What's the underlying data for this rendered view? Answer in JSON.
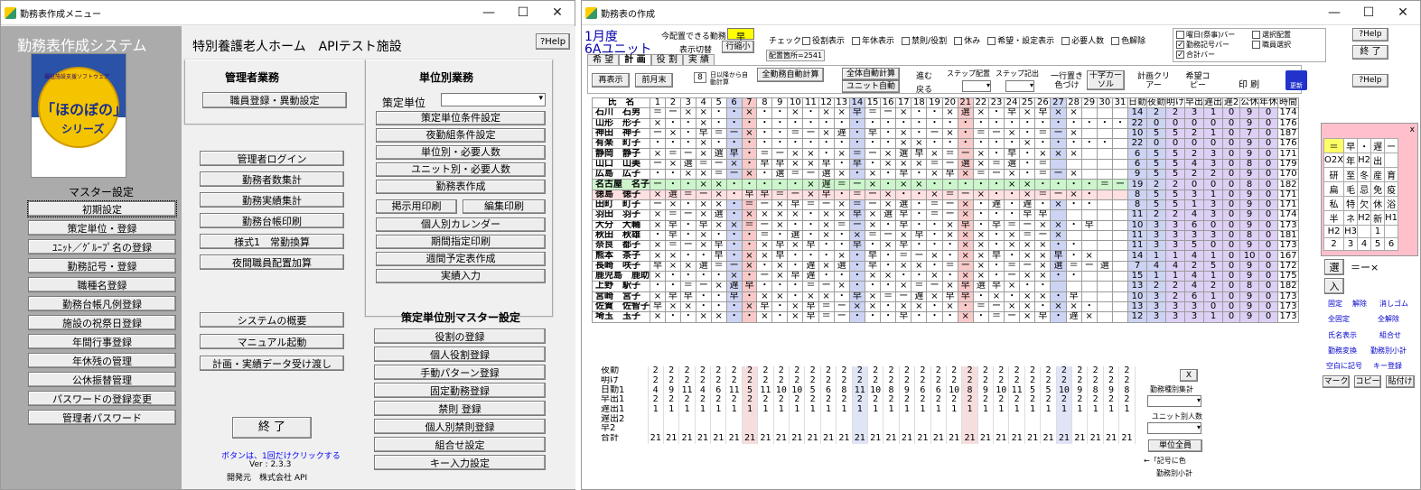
{
  "w1": {
    "title": "勤務表作成メニュー",
    "min": "—",
    "max": "☐",
    "close": "✕"
  },
  "side": {
    "app_title": "勤務表作成システム",
    "logo_arc": "福祉施設支援ソフトウェア",
    "logo_main": "「ほのぼの」",
    "logo_sub": "シリーズ",
    "master": "マスター設定",
    "items": [
      "初期設定",
      "策定単位・登録",
      "ﾕﾆｯﾄ／ｸﾞﾙｰﾌﾟ名の登録",
      "勤務記号・登録",
      "職種名登録",
      "勤務台帳凡例登録",
      "施設の祝祭日登録",
      "年間行事登録",
      "年休残の管理",
      "公休振替管理",
      "パスワードの登録変更",
      "管理者パスワード"
    ]
  },
  "mainp": {
    "facility": "特別養護老人ホーム　APIテスト施設",
    "help": "?Help",
    "admin_h": "管理者業務",
    "staff_btn": "職員登録・異動設定",
    "unit_h": "単位別業務",
    "unit_label": "策定単位",
    "unit_btns": [
      "策定単位条件設定",
      "夜勤組条件設定",
      "単位別・必要人数",
      "ユニット別・必要人数",
      "勤務表作成"
    ],
    "print_a": "掲示用印刷",
    "print_b": "編集印刷",
    "unit_btns2": [
      "個人別カレンダー",
      "期間指定印刷",
      "週間予定表作成",
      "実績入力"
    ],
    "left_btns": [
      "管理者ログイン",
      "勤務者数集計",
      "勤務実績集計",
      "勤務台帳印刷",
      "様式1　常勤換算",
      "夜間職員配置加算"
    ],
    "left_btns2": [
      "システムの概要",
      "マニュアル起動",
      "計画・実績データ受け渡し"
    ],
    "master_h": "策定単位別マスター設定",
    "master_btns": [
      "役割の登録",
      "個人役割登録",
      "手動パターン登録",
      "固定勤務登録",
      "禁則 登録",
      "個人別禁則登録",
      "組合せ設定",
      "キー入力設定"
    ],
    "exit": "終 了",
    "note": "ボタンは、1回だけクリックする",
    "ver": "Ver : 2.3.3",
    "dev": "開発元　株式会社 API"
  },
  "w2": {
    "title": "勤務表の作成",
    "month": "1月度",
    "unit": "6Aユニット",
    "today_lbl": "今配置できる勤務",
    "today_val": "早",
    "view_lbl": "表示切替",
    "view_btn": "行縮小",
    "place": "配置箇所=2541",
    "check_lbl": "チェック",
    "checks": [
      "役割表示",
      "年休表示",
      "禁則/役割",
      "休み",
      "希望・設定表示",
      "必要人数",
      "色解除"
    ],
    "checks2": [
      "曜日(祭事)バー",
      "勤務記号バー",
      "合計バー"
    ],
    "checks3": [
      "選択配置",
      "職員選択"
    ],
    "help": "?Help",
    "end": "終 了",
    "tabs": [
      "希 望",
      "計 画",
      "役 割",
      "実 績"
    ],
    "t_btns": [
      "再表示",
      "前月末"
    ],
    "day_box": "8",
    "day_txt": "日以降から自動計算",
    "auto_all": "全勤務自動計算",
    "auto_full": "全体自動計算",
    "auto_unit": "ユニット自動",
    "go": "進む",
    "back": "戻る",
    "step1": "ステップ配置",
    "step2": "ステップ記出",
    "overwrite": "一行置き色づけ",
    "cross": "十字カーソル",
    "clear": "計画クリアー",
    "copy": "希望コピー",
    "print": "印 刷",
    "save": "更新",
    "colhdr": "氏　名",
    "days": [
      "1",
      "2",
      "3",
      "4",
      "5",
      "6",
      "7",
      "8",
      "9",
      "10",
      "11",
      "12",
      "13",
      "14",
      "15",
      "16",
      "17",
      "18",
      "19",
      "20",
      "21",
      "22",
      "23",
      "24",
      "25",
      "26",
      "27",
      "28",
      "29",
      "30",
      "31"
    ],
    "tothdr": [
      "日勤",
      "夜勤",
      "明け",
      "早出",
      "遅出",
      "遅2",
      "公休",
      "年休",
      "時間"
    ],
    "rows": [
      {
        "n": "石川　石男",
        "d": "＝ー×× ・・×・・×・××早＝ー× ・・× 選× ・早 ×早××",
        "t": [
          "14",
          "2",
          "2",
          "3",
          "1",
          "0",
          "9",
          "0",
          "174"
        ]
      },
      {
        "n": "山形　形子",
        "d": "×・・× ・・・・・・・・・・・・・・・・・・・・・・・・・・・",
        "t": [
          "22",
          "0",
          "0",
          "0",
          "0",
          "0",
          "9",
          "0",
          "176"
        ]
      },
      {
        "n": "神田　神子",
        "d": "ー×・ 早＝ー×・・＝ー× 遅・早・× ・ー× ・＝ー× ・＝ー×",
        "t": [
          "10",
          "5",
          "5",
          "2",
          "1",
          "0",
          "7",
          "0",
          "187"
        ]
      },
      {
        "n": "有楽　町子",
        "d": "・・・×・・・・・・・・・・・・××・・・・・・ ×・・・・・",
        "t": [
          "22",
          "0",
          "0",
          "0",
          "0",
          "0",
          "9",
          "0",
          "176"
        ]
      },
      {
        "n": "静岡　静子",
        "d": "×＝ー× 選早・＝ー××・×＝ー× 選早×＝ー× ・早・×××",
        "t": [
          "6",
          "5",
          "5",
          "2",
          "3",
          "0",
          "9",
          "0",
          "171"
        ]
      },
      {
        "n": "山口　山美",
        "d": "ー× 選＝ー× ・早早××早・早・××× ＝ー選× ＝選・＝",
        "t": [
          "6",
          "5",
          "5",
          "4",
          "3",
          "0",
          "8",
          "0",
          "179"
        ]
      },
      {
        "n": "広島　広子",
        "d": "・・××＝ー× ・選＝ー選× ・× ・早・× 早×＝ー× ・＝ー×",
        "t": [
          "9",
          "5",
          "5",
          "2",
          "2",
          "0",
          "9",
          "0",
          "170"
        ]
      },
      {
        "n": "名古屋　名子",
        "d": "ー・・××・・・・・× 遅＝ー× ・××・・・・・×× ・・・・＝ー",
        "t": [
          "19",
          "2",
          "2",
          "0",
          "0",
          "0",
          "8",
          "0",
          "182"
        ]
      },
      {
        "n": "徳島　徳子",
        "d": "× 選＝ー× ・早早＝ー× 早・＝ー× ・・×＝ー× ・・×＝ー× ・",
        "t": [
          "8",
          "5",
          "5",
          "3",
          "1",
          "0",
          "9",
          "0",
          "171"
        ]
      },
      {
        "n": "田町　町子",
        "d": "ー×・××・＝ー×早＝ー× ＝ー× 選・＝ー× ・遅・遅・×・・",
        "t": [
          "8",
          "5",
          "5",
          "1",
          "3",
          "0",
          "9",
          "0",
          "171"
        ]
      },
      {
        "n": "羽田　羽子",
        "d": "× ＝ー× 選・×××× ・×× 早× 選早・＝ー× ・・・早早",
        "t": [
          "11",
          "2",
          "2",
          "4",
          "3",
          "0",
          "9",
          "0",
          "174"
        ]
      },
      {
        "n": "大分　大輔",
        "d": "× 早・早××＝ー× ・・× ＝ー× ・早・・× 早・早＝ー××・早",
        "t": [
          "10",
          "3",
          "3",
          "6",
          "0",
          "0",
          "9",
          "0",
          "173"
        ]
      },
      {
        "n": "秋田　秋雄",
        "d": "・早・× ・・・＝・ 選・× ・× ＝ー× 早・× ×× ・×＝ー×",
        "t": [
          "11",
          "3",
          "3",
          "3",
          "3",
          "0",
          "8",
          "0",
          "181"
        ]
      },
      {
        "n": "奈良　都子",
        "d": "×＝ー× 早・・× 早×早・・早・×早・・・×× ・×××・・",
        "t": [
          "11",
          "3",
          "3",
          "5",
          "0",
          "0",
          "9",
          "0",
          "173"
        ]
      },
      {
        "n": "熊本　茶子",
        "d": "××・・早・×× 早・・・× ・早・＝ー× ・××早・×× 早・×",
        "t": [
          "14",
          "1",
          "1",
          "4",
          "1",
          "0",
          "10",
          "0",
          "167"
        ]
      },
      {
        "n": "長崎　咲子",
        "d": "早×× 選＝ー× ・× ・遅× 選・早・××・＝ー× ・＝ー× 選＝ー選",
        "t": [
          "7",
          "4",
          "4",
          "2",
          "5",
          "0",
          "9",
          "0",
          "172"
        ]
      },
      {
        "n": "鹿児島　鹿助",
        "d": "× ・・・・× ・ー× 早遅・・・××・・× ・××・ー××・・",
        "t": [
          "15",
          "1",
          "1",
          "4",
          "1",
          "0",
          "9",
          "0",
          "175"
        ]
      },
      {
        "n": "上野　駅子",
        "d": "・・＝ー× 遅早・・・＝ー× ・・・× ＝ー× 早 選早×・・",
        "t": [
          "13",
          "2",
          "2",
          "4",
          "2",
          "0",
          "8",
          "0",
          "182"
        ]
      },
      {
        "n": "宮崎　宮子",
        "d": "× 早早・・早・××・××・早× ＝ー遅× 早早・× ・××・早",
        "t": [
          "10",
          "3",
          "2",
          "6",
          "1",
          "0",
          "9",
          "0",
          "173"
        ]
      },
      {
        "n": "佐賀　佐智子",
        "d": "早××・・・× 早・× 早＝ー××・××・× ・＝ー×× ・××・",
        "t": [
          "13",
          "3",
          "3",
          "3",
          "0",
          "0",
          "9",
          "0",
          "173"
        ]
      },
      {
        "n": "埼玉　玉子",
        "d": "×・・××・・× ・×早＝ー・・・早・・・× ・＝ー× 早・遅×",
        "t": [
          "12",
          "3",
          "3",
          "3",
          "1",
          "0",
          "9",
          "0",
          "173"
        ]
      }
    ],
    "sum_lbls": [
      "夜勤",
      "明け",
      "日勤1",
      "早出1",
      "遅出1",
      "遅出2",
      "早2",
      "合計"
    ],
    "sum": [
      [
        "2",
        "2",
        "2",
        "2",
        "2",
        "2",
        "2",
        "2",
        "2",
        "2",
        "2",
        "2",
        "2",
        "2",
        "2",
        "2",
        "2",
        "2",
        "2",
        "2",
        "2",
        "2",
        "2",
        "2",
        "2",
        "2",
        "2",
        "2",
        "2",
        "2",
        "2"
      ],
      [
        "2",
        "2",
        "2",
        "2",
        "2",
        "2",
        "2",
        "2",
        "2",
        "2",
        "2",
        "2",
        "2",
        "2",
        "2",
        "2",
        "2",
        "2",
        "2",
        "2",
        "2",
        "2",
        "2",
        "2",
        "2",
        "2",
        "2",
        "2",
        "2",
        "2",
        "2"
      ],
      [
        "4",
        "9",
        "11",
        "4",
        "6",
        "11",
        "5",
        "11",
        "10",
        "10",
        "5",
        "6",
        "8",
        "11",
        "10",
        "8",
        "9",
        "6",
        "6",
        "10",
        "8",
        "9",
        "10",
        "11",
        "5",
        "5",
        "10",
        "9",
        "8",
        "9",
        "8"
      ],
      [
        "2",
        "2",
        "2",
        "2",
        "2",
        "2",
        "2",
        "2",
        "2",
        "2",
        "2",
        "2",
        "2",
        "2",
        "2",
        "2",
        "2",
        "2",
        "2",
        "2",
        "2",
        "2",
        "2",
        "2",
        "2",
        "2",
        "2",
        "2",
        "2",
        "2",
        "2"
      ],
      [
        "1",
        "1",
        "1",
        "1",
        "1",
        "1",
        "1",
        "1",
        "1",
        "1",
        "1",
        "1",
        "1",
        "1",
        "1",
        "1",
        "1",
        "1",
        "1",
        "1",
        "1",
        "1",
        "1",
        "1",
        "1",
        "1",
        "1",
        "1",
        "1",
        "1",
        "1"
      ],
      [
        "",
        "",
        "",
        "",
        "",
        "",
        "",
        "",
        "",
        "",
        "",
        "",
        "",
        "",
        "",
        "",
        "",
        "",
        "",
        "",
        "",
        "",
        "",
        "",
        "",
        "",
        "",
        "",
        "",
        "",
        ""
      ],
      [
        "",
        "",
        "",
        "",
        "",
        "",
        "",
        "",
        "",
        "",
        "",
        "",
        "",
        "",
        "",
        "",
        "",
        "",
        "",
        "",
        "",
        "",
        "",
        "",
        "",
        "",
        "",
        "",
        "",
        "",
        ""
      ],
      [
        "21",
        "21",
        "21",
        "21",
        "21",
        "21",
        "21",
        "21",
        "21",
        "21",
        "21",
        "21",
        "21",
        "21",
        "21",
        "21",
        "21",
        "21",
        "21",
        "21",
        "21",
        "21",
        "21",
        "21",
        "21",
        "21",
        "21",
        "21",
        "21",
        "21",
        "21"
      ]
    ],
    "x_btn": "X",
    "cnt_lbl": "勤務種別集計",
    "unit_cnt": "ユニット別人数",
    "unit_all": "単位全員",
    "legend": "←「記号に色",
    "legend2": "勤務別小計",
    "pal_grid": [
      "＝",
      "早",
      "・",
      "遅",
      "ー",
      "O2X",
      "年",
      "H2",
      "出",
      "",
      "研",
      "至",
      "冬",
      "産",
      "育",
      "扁",
      "毛",
      "忌",
      "免",
      "疫",
      "私",
      "特",
      "欠",
      "休",
      "浴",
      "半",
      "ネ",
      "H2",
      "新",
      "H1",
      "H2",
      "H3",
      "",
      "1",
      "",
      "2",
      "3",
      "4",
      "5",
      "6"
    ],
    "pal_sel": "選",
    "pal_sel_val": "＝ー×",
    "pal_in": "入",
    "pal_links": [
      "固定",
      "解除",
      "消しゴム",
      "全固定",
      "全解除",
      "氏名表示",
      "組合せ",
      "勤務変換",
      "勤務別小計",
      "空白に記号",
      "キー登録"
    ],
    "pal_mark": "マーク",
    "pal_copy": "コピー",
    "pal_paste": "貼付け",
    "pal_close": "x"
  }
}
